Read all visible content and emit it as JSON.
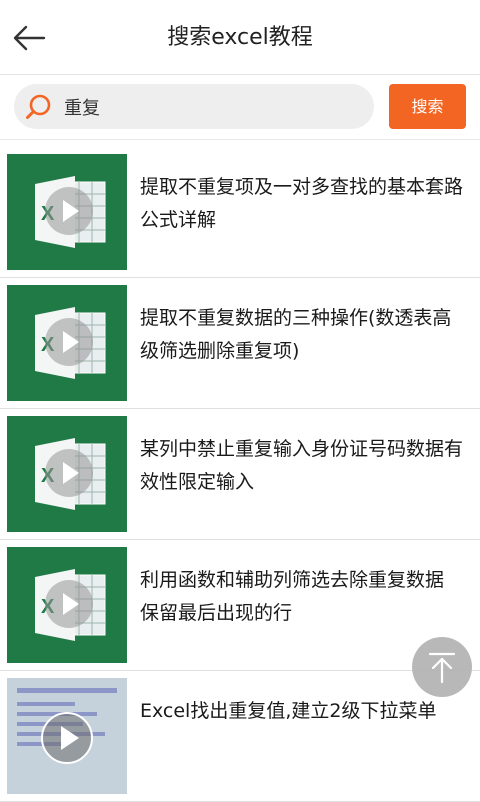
{
  "header": {
    "title": "搜索excel教程",
    "back_icon": "arrow-left-icon"
  },
  "search": {
    "value": "重复",
    "button_label": "搜索",
    "icon": "search-icon"
  },
  "results": [
    {
      "title": "提取不重复项及一对多查找的基本套路公式详解",
      "thumb": "excel-video-thumbnail"
    },
    {
      "title": "提取不重复数据的三种操作(数透表高级筛选删除重复项)",
      "thumb": "excel-video-thumbnail"
    },
    {
      "title": "某列中禁止重复输入身份证号码数据有效性限定输入",
      "thumb": "excel-video-thumbnail"
    },
    {
      "title": "利用函数和辅助列筛选去除重复数据 保留最后出现的行",
      "thumb": "excel-video-thumbnail"
    },
    {
      "title": "Excel找出重复值,建立2级下拉菜单",
      "thumb": "screenshot-video-thumbnail"
    }
  ],
  "colors": {
    "accent": "#f26522",
    "excel_green": "#1f7a45"
  },
  "floating": {
    "scroll_top_icon": "arrow-up-to-top-icon"
  }
}
